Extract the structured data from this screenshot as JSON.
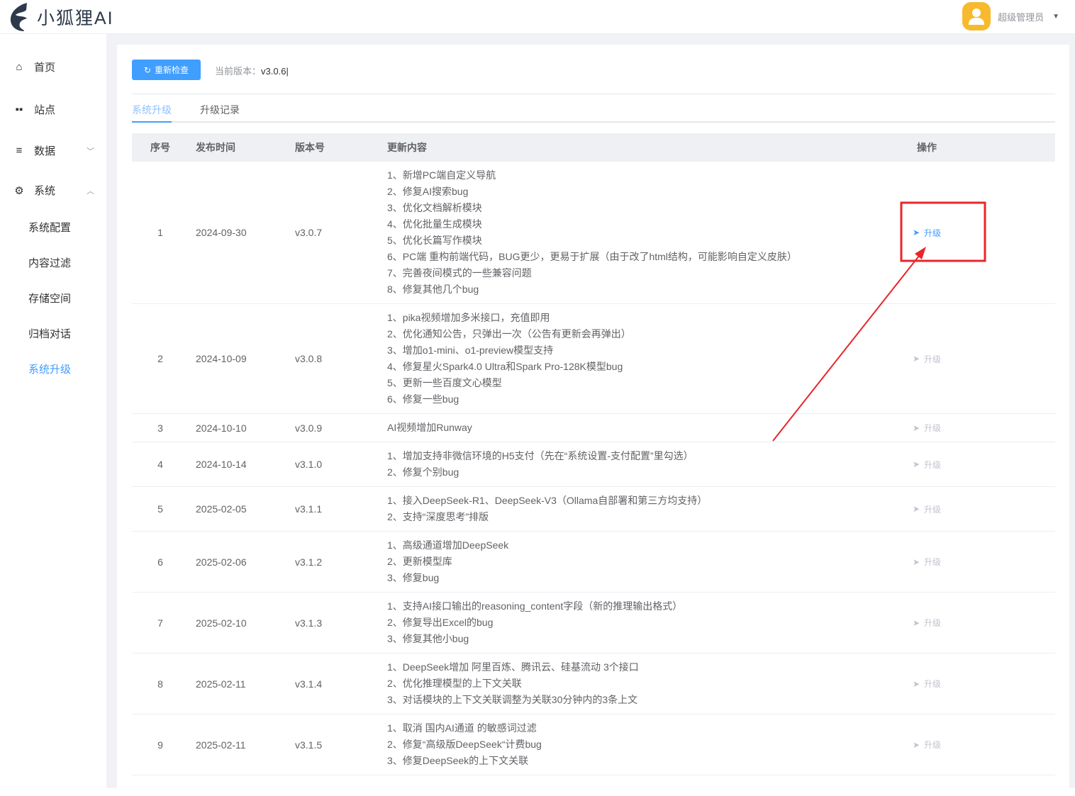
{
  "app": {
    "title": "小狐狸AI"
  },
  "user": {
    "name": "超级管理员"
  },
  "sidebar": {
    "items": [
      {
        "label": "首页",
        "icon": "home-icon"
      },
      {
        "label": "站点",
        "icon": "grid-icon"
      },
      {
        "label": "数据",
        "icon": "menu-icon"
      },
      {
        "label": "系统",
        "icon": "gear-icon"
      }
    ],
    "sub_items": [
      "系统配置",
      "内容过滤",
      "存储空间",
      "归档对话",
      "系统升级"
    ]
  },
  "toolbar": {
    "recheck_label": "重新检查",
    "current_version_label": "当前版本：",
    "current_version": "v3.0.6"
  },
  "tabs": [
    "系统升级",
    "升级记录"
  ],
  "table": {
    "headers": [
      "序号",
      "发布时间",
      "版本号",
      "更新内容",
      "操作"
    ],
    "action_label": "升级",
    "rows": [
      {
        "no": "1",
        "date": "2024-09-30",
        "version": "v3.0.7",
        "active": true,
        "changes": [
          "1、新增PC端自定义导航",
          "2、修复AI搜索bug",
          "3、优化文档解析模块",
          "4、优化批量生成模块",
          "5、优化长篇写作模块",
          "6、PC端 重构前端代码，BUG更少，更易于扩展（由于改了html结构，可能影响自定义皮肤）",
          "7、完善夜间模式的一些兼容问题",
          "8、修复其他几个bug"
        ]
      },
      {
        "no": "2",
        "date": "2024-10-09",
        "version": "v3.0.8",
        "changes": [
          "1、pika视频增加多米接口，充值即用",
          "2、优化通知公告，只弹出一次（公告有更新会再弹出）",
          "3、增加o1-mini、o1-preview模型支持",
          "4、修复星火Spark4.0 Ultra和Spark Pro-128K模型bug",
          "5、更新一些百度文心模型",
          "6、修复一些bug"
        ]
      },
      {
        "no": "3",
        "date": "2024-10-10",
        "version": "v3.0.9",
        "changes": [
          "AI视频增加Runway"
        ]
      },
      {
        "no": "4",
        "date": "2024-10-14",
        "version": "v3.1.0",
        "changes": [
          "1、增加支持非微信环境的H5支付（先在“系统设置-支付配置”里勾选）",
          "2、修复个别bug"
        ]
      },
      {
        "no": "5",
        "date": "2025-02-05",
        "version": "v3.1.1",
        "changes": [
          "1、接入DeepSeek-R1、DeepSeek-V3（Ollama自部署和第三方均支持）",
          "2、支持“深度思考”排版"
        ]
      },
      {
        "no": "6",
        "date": "2025-02-06",
        "version": "v3.1.2",
        "changes": [
          "1、高级通道增加DeepSeek",
          "2、更新模型库",
          "3、修复bug"
        ]
      },
      {
        "no": "7",
        "date": "2025-02-10",
        "version": "v3.1.3",
        "changes": [
          "1、支持AI接口输出的reasoning_content字段（新的推理输出格式）",
          "2、修复导出Excel的bug",
          "3、修复其他小bug"
        ]
      },
      {
        "no": "8",
        "date": "2025-02-11",
        "version": "v3.1.4",
        "changes": [
          "1、DeepSeek增加 阿里百炼、腾讯云、硅基流动 3个接口",
          "2、优化推理模型的上下文关联",
          "3、对话模块的上下文关联调整为关联30分钟内的3条上文"
        ]
      },
      {
        "no": "9",
        "date": "2025-02-11",
        "version": "v3.1.5",
        "changes": [
          "1、取消 国内AI通道 的敏感词过滤",
          "2、修复“高级版DeepSeek“计费bug",
          "3、修复DeepSeek的上下文关联"
        ]
      }
    ]
  },
  "colors": {
    "accent": "#409eff",
    "annotation": "#e8262a",
    "avatar": "#f7b92e"
  }
}
